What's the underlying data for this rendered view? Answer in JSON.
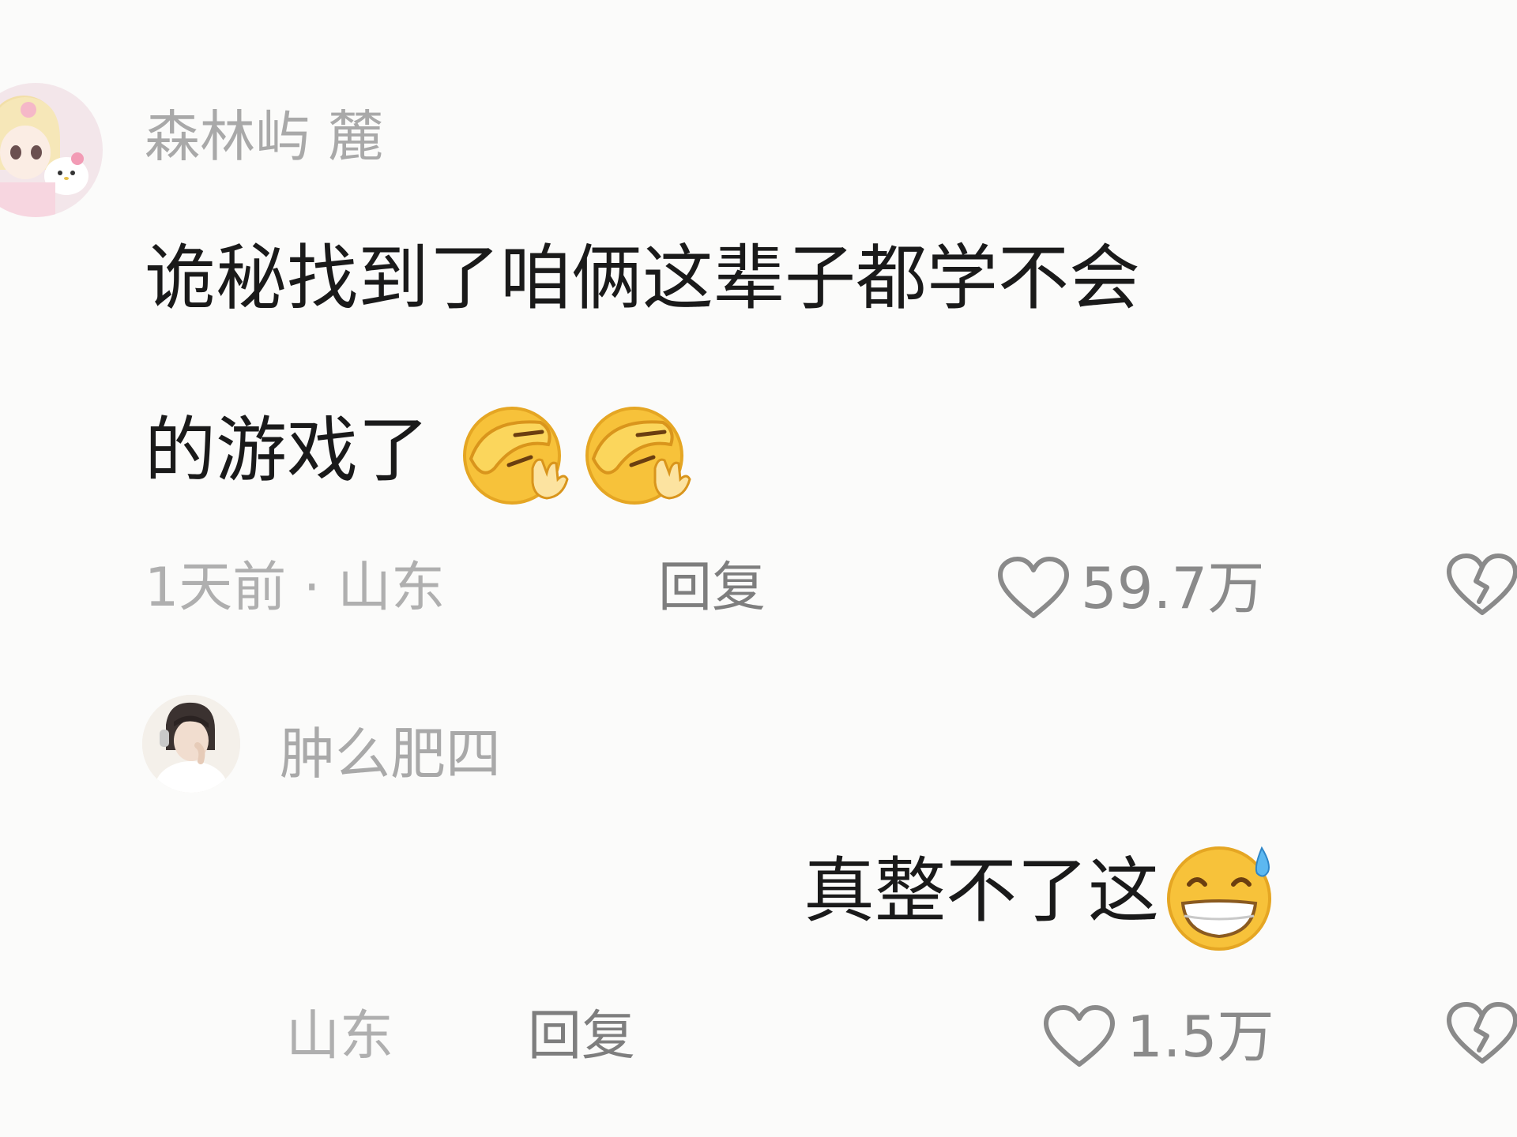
{
  "comments": [
    {
      "username": "森林屿 麓",
      "text": "诡秘找到了咱俩这辈子都学不会",
      "text_line2": "的游戏了",
      "emojis": [
        "face-palm-emoji",
        "face-palm-emoji"
      ],
      "time": "1天前",
      "separator": "·",
      "location": "山东",
      "reply_label": "回复",
      "like_count": "59.7万",
      "like_icon": "heart-outline-icon",
      "dislike_icon": "broken-heart-icon"
    },
    {
      "username": "肿么肥四",
      "text": "真整不了这",
      "emojis": [
        "grinning-sweat-emoji"
      ],
      "location": "山东",
      "reply_label": "回复",
      "like_count": "1.5万",
      "like_icon": "heart-outline-icon",
      "dislike_icon": "broken-heart-icon"
    }
  ],
  "colors": {
    "background": "#FBFBFA",
    "username": "#A9A9A9",
    "comment_text": "#1A1A1A",
    "meta": "#AFAFAF",
    "reply": "#7E7E7E",
    "icon": "#8A8A8A"
  }
}
